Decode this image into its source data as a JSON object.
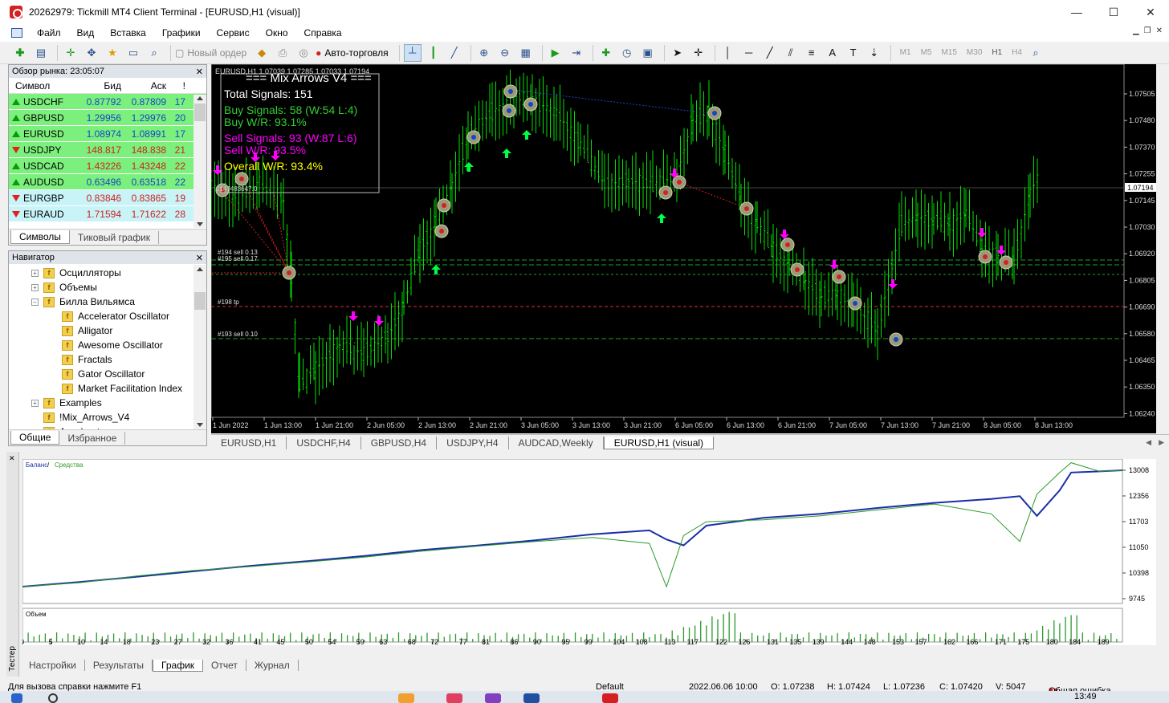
{
  "window": {
    "title": "20262979: Tickmill MT4 Client Terminal - [EURUSD,H1 (visual)]"
  },
  "menu": [
    "Файл",
    "Вид",
    "Вставка",
    "Графики",
    "Сервис",
    "Окно",
    "Справка"
  ],
  "toolbar": {
    "new_order": "Новый ордер",
    "autotrading": "Авто-торговля",
    "timeframes": [
      "M1",
      "M5",
      "M15",
      "M30",
      "H1",
      "H4"
    ]
  },
  "market_watch": {
    "title": "Обзор рынка: 23:05:07",
    "columns": [
      "Символ",
      "Бид",
      "Аск",
      "!"
    ],
    "rows": [
      {
        "symbol": "USDCHF",
        "bid": "0.87792",
        "ask": "0.87809",
        "spread": "17"
      },
      {
        "symbol": "GBPUSD",
        "bid": "1.29956",
        "ask": "1.29976",
        "spread": "20"
      },
      {
        "symbol": "EURUSD",
        "bid": "1.08974",
        "ask": "1.08991",
        "spread": "17"
      },
      {
        "symbol": "USDJPY",
        "bid": "148.817",
        "ask": "148.838",
        "spread": "21"
      },
      {
        "symbol": "USDCAD",
        "bid": "1.43226",
        "ask": "1.43248",
        "spread": "22"
      },
      {
        "symbol": "AUDUSD",
        "bid": "0.63496",
        "ask": "0.63518",
        "spread": "22"
      },
      {
        "symbol": "EURGBP",
        "bid": "0.83846",
        "ask": "0.83865",
        "spread": "19"
      },
      {
        "symbol": "EURAUD",
        "bid": "1.71594",
        "ask": "1.71622",
        "spread": "28"
      }
    ],
    "tabs": [
      "Символы",
      "Тиковый график"
    ]
  },
  "navigator": {
    "title": "Навигатор",
    "items": [
      {
        "label": "Осцилляторы",
        "level": 1,
        "expander": "+"
      },
      {
        "label": "Объемы",
        "level": 1,
        "expander": "+"
      },
      {
        "label": "Билла Вильямса",
        "level": 1,
        "expander": "−"
      },
      {
        "label": "Accelerator Oscillator",
        "level": 2,
        "expander": ""
      },
      {
        "label": "Alligator",
        "level": 2,
        "expander": ""
      },
      {
        "label": "Awesome Oscillator",
        "level": 2,
        "expander": ""
      },
      {
        "label": "Fractals",
        "level": 2,
        "expander": ""
      },
      {
        "label": "Gator Oscillator",
        "level": 2,
        "expander": ""
      },
      {
        "label": "Market Facilitation Index",
        "level": 2,
        "expander": ""
      },
      {
        "label": "Examples",
        "level": 1,
        "expander": "+"
      },
      {
        "label": "!Mix_Arrows_V4",
        "level": 1,
        "expander": ""
      },
      {
        "label": "Accelerator",
        "level": 1,
        "expander": ""
      }
    ],
    "tabs": [
      "Общие",
      "Избранное"
    ]
  },
  "chart": {
    "header": "EURUSD,H1  1.07039 1.07285 1.07033 1.07194",
    "panel": {
      "title": "=== Mix Arrows V4 ===",
      "total": "Total Signals: 151",
      "buy_signals": "Buy Signals: 58 (W:54 L:4)",
      "buy_wr": "Buy W/R: 93.1%",
      "sell_signals": "Sell Signals: 93 (W:87 L:6)",
      "sell_wr": "Sell W/R: 93.5%",
      "overall_wr": "Overall W/R: 93.4%"
    },
    "price_levels": [
      "1.07505",
      "1.07480",
      "1.07370",
      "1.07255",
      "1.07145",
      "1.07030",
      "1.06920",
      "1.06805",
      "1.06690",
      "1.06580",
      "1.06465",
      "1.06350",
      "1.06240"
    ],
    "current_price": "1.07194",
    "time_labels": [
      "1 Jun 2022",
      "1 Jun 13:00",
      "1 Jun 21:00",
      "2 Jun 05:00",
      "2 Jun 13:00",
      "2 Jun 21:00",
      "3 Jun 05:00",
      "3 Jun 13:00",
      "3 Jun 21:00",
      "6 Jun 05:00",
      "6 Jun 13:00",
      "6 Jun 21:00",
      "7 Jun 05:00",
      "7 Jun 13:00",
      "7 Jun 21:00",
      "8 Jun 05:00",
      "8 Jun 13:00"
    ],
    "order_labels": [
      "#194 sell 0.13",
      "#195 sell 0.17",
      "#198 tp",
      "#193 sell 0.10"
    ],
    "small_label": "2147483647.0",
    "colors": {
      "up": "#00ff00",
      "dn": "#00ff00",
      "buy": "#00ff44",
      "sell": "#ff00ff",
      "panel_title": "#ffffff",
      "buy_text": "#32cd32",
      "sell_text": "#ff00ff",
      "overall_text": "#ffff00"
    }
  },
  "chart_tabs": [
    "EURUSD,H1",
    "USDCHF,H4",
    "GBPUSD,H4",
    "USDJPY,H4",
    "AUDCAD,Weekly",
    "EURUSD,H1 (visual)"
  ],
  "tester": {
    "side_label": "Тестер",
    "legend_balance": "Баланс",
    "legend_sep": " / ",
    "legend_equity": "Средства",
    "volume_label": "Объем",
    "y_labels": [
      "13008",
      "12356",
      "11703",
      "11050",
      "10398",
      "9745"
    ],
    "x_labels": [
      "0",
      "5",
      "10",
      "14",
      "18",
      "23",
      "27",
      "32",
      "36",
      "41",
      "45",
      "50",
      "54",
      "59",
      "63",
      "68",
      "72",
      "77",
      "81",
      "86",
      "90",
      "95",
      "99",
      "104",
      "108",
      "113",
      "117",
      "122",
      "126",
      "131",
      "135",
      "139",
      "144",
      "148",
      "153",
      "157",
      "162",
      "166",
      "171",
      "175",
      "180",
      "184",
      "189"
    ],
    "tabs": [
      "Настройки",
      "Результаты",
      "График",
      "Отчет",
      "Журнал"
    ],
    "chart_data": {
      "type": "line",
      "ylim": [
        9745,
        13008
      ],
      "x": [
        0,
        10,
        20,
        30,
        40,
        50,
        60,
        70,
        80,
        90,
        100,
        110,
        113,
        116,
        120,
        130,
        140,
        150,
        160,
        170,
        175,
        178,
        182,
        184,
        189,
        193
      ],
      "series": [
        {
          "name": "Баланс",
          "values": [
            10050,
            10170,
            10300,
            10440,
            10580,
            10700,
            10830,
            10980,
            11100,
            11230,
            11380,
            11480,
            11250,
            11100,
            11600,
            11800,
            11900,
            12050,
            12180,
            12280,
            12350,
            11850,
            12500,
            12950,
            12980,
            13008
          ]
        },
        {
          "name": "Средства",
          "values": [
            10050,
            10150,
            10320,
            10460,
            10560,
            10680,
            10800,
            10950,
            11080,
            11200,
            11300,
            11150,
            10050,
            11350,
            11700,
            11750,
            11850,
            12000,
            12150,
            11900,
            11200,
            12400,
            12950,
            13200,
            12980,
            13008
          ]
        }
      ]
    }
  },
  "statusbar": {
    "help": "Для вызова справки нажмите F1",
    "profile": "Default",
    "datetime": "2022.06.06 10:00",
    "open": "O: 1.07238",
    "high": "H: 1.07424",
    "low": "L: 1.07236",
    "close": "C: 1.07420",
    "volume": "V: 5047",
    "error": "Общая ошибка"
  },
  "taskbar": {
    "time": "13:49"
  }
}
